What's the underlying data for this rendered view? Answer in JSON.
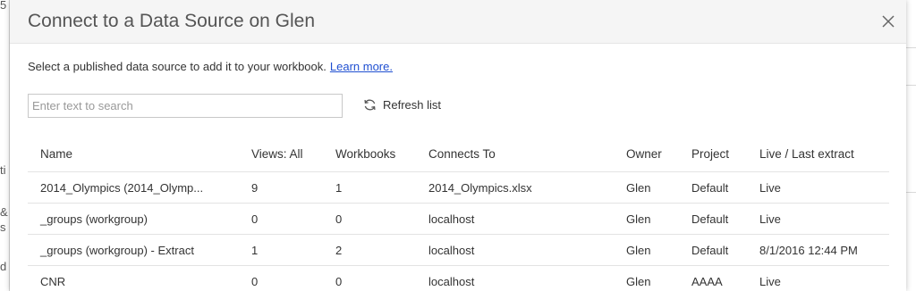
{
  "background": {
    "left_chars": [
      "5",
      "ti",
      "&",
      "s",
      "d"
    ]
  },
  "dialog": {
    "title": "Connect to a Data Source on Glen",
    "close_glyph": "✕",
    "intro_text": "Select a published data source to add it to your workbook.",
    "learn_more": "Learn more.",
    "search": {
      "placeholder": "Enter text to search",
      "value": ""
    },
    "refresh_label": "Refresh list"
  },
  "table": {
    "headers": [
      "Name",
      "Views: All",
      "Workbooks",
      "Connects To",
      "Owner",
      "Project",
      "Live / Last extract"
    ],
    "rows": [
      [
        "2014_Olympics (2014_Olymp...",
        "9",
        "1",
        "2014_Olympics.xlsx",
        "Glen",
        "Default",
        "Live"
      ],
      [
        "_groups (workgroup)",
        "0",
        "0",
        "localhost",
        "Glen",
        "Default",
        "Live"
      ],
      [
        "_groups (workgroup) - Extract",
        "1",
        "2",
        "localhost",
        "Glen",
        "Default",
        "8/1/2016 12:44 PM"
      ],
      [
        "CNR",
        "0",
        "0",
        "localhost",
        "Glen",
        "AAAA",
        "Live"
      ]
    ]
  },
  "colors": {
    "link": "#1f4fd1",
    "header_bg": "#f5f5f5",
    "text": "#333333"
  }
}
